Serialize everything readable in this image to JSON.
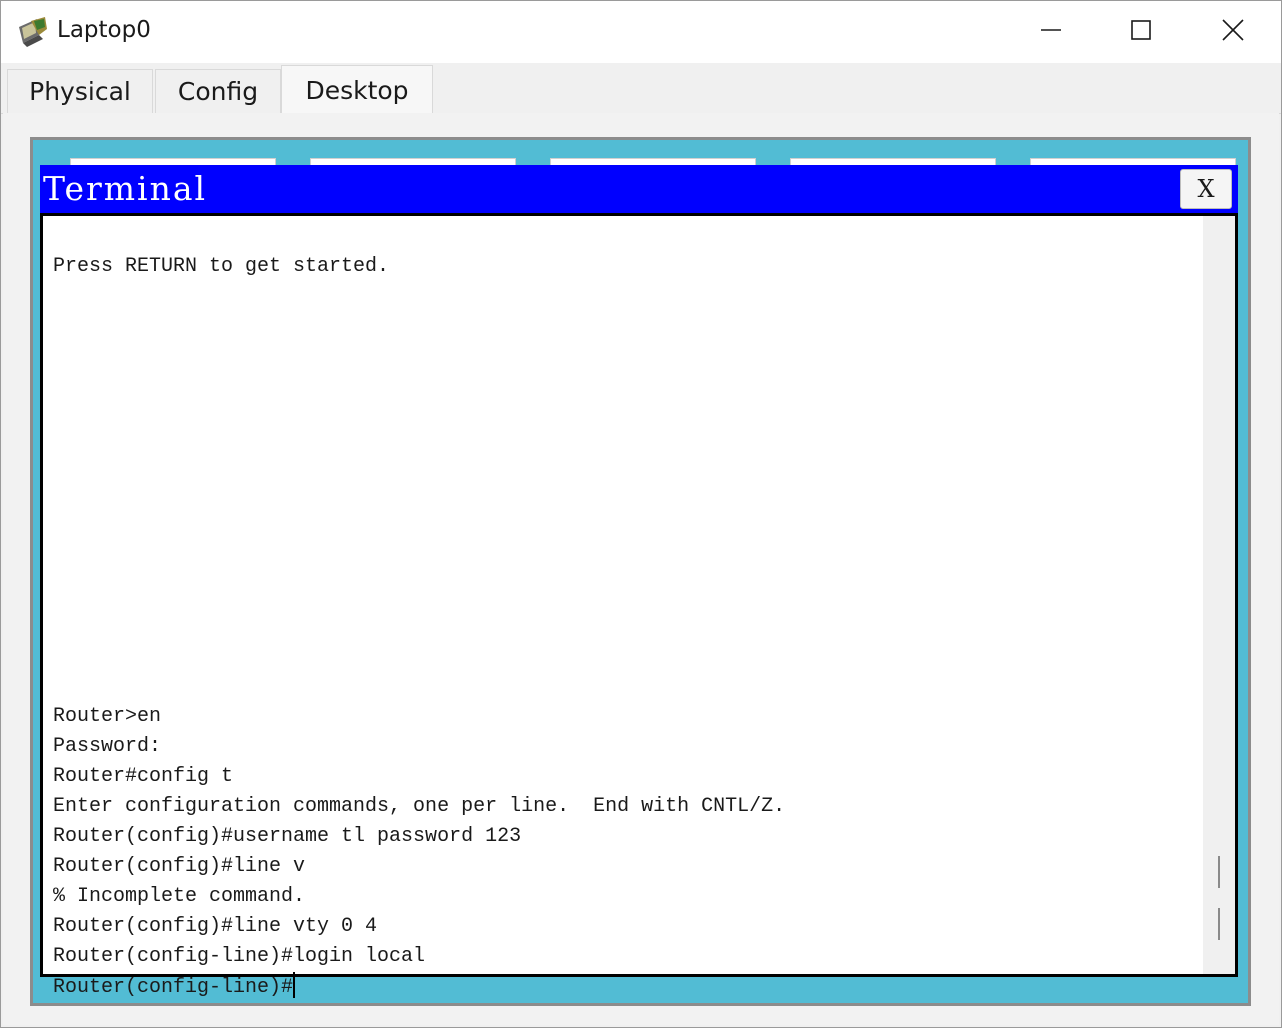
{
  "window": {
    "title": "Laptop0",
    "icons": {
      "app": "laptop-icon",
      "minimize": "minimize-icon",
      "maximize": "maximize-icon",
      "close": "close-icon"
    }
  },
  "tabs": [
    {
      "label": "Physical",
      "active": false
    },
    {
      "label": "Config",
      "active": false
    },
    {
      "label": "Desktop",
      "active": true
    }
  ],
  "terminal": {
    "title": "Terminal",
    "close_label": "X",
    "lines": [
      "Press RETURN to get started.",
      "",
      "",
      "",
      "",
      "",
      "",
      "",
      "",
      "",
      "",
      "",
      "",
      "",
      "",
      "Router>en",
      "Password:",
      "Router#config t",
      "Enter configuration commands, one per line.  End with CNTL/Z.",
      "Router(config)#username tl password 123",
      "Router(config)#line v",
      "% Incomplete command.",
      "Router(config)#line vty 0 4",
      "Router(config-line)#login local",
      "Router(config-line)#"
    ]
  },
  "colors": {
    "desktop_background": "#52bcd4",
    "terminal_header": "#0000ff",
    "terminal_text": "#1a1a1a"
  }
}
